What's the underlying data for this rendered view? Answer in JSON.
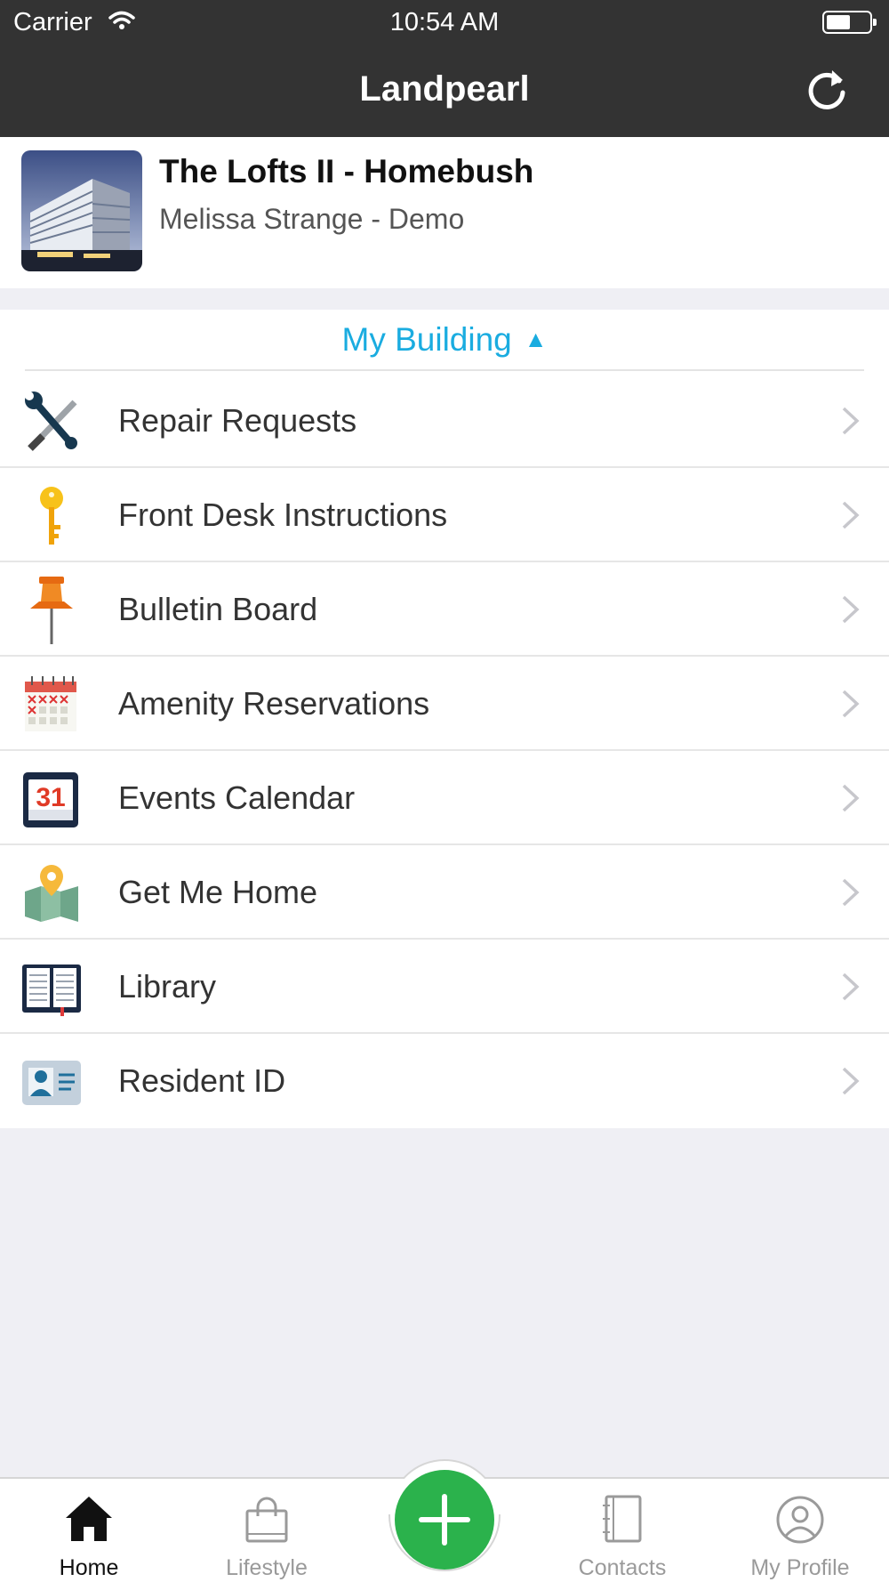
{
  "status_bar": {
    "carrier": "Carrier",
    "time": "10:54 AM"
  },
  "nav": {
    "title": "Landpearl"
  },
  "property": {
    "name": "The Lofts II - Homebush",
    "subtitle": "Melissa Strange - Demo"
  },
  "section": {
    "title": "My Building",
    "caret": "▲"
  },
  "menu": [
    {
      "label": "Repair Requests",
      "icon": "tools-icon"
    },
    {
      "label": "Front Desk Instructions",
      "icon": "key-icon"
    },
    {
      "label": "Bulletin Board",
      "icon": "pushpin-icon"
    },
    {
      "label": "Amenity Reservations",
      "icon": "reservation-calendar-icon"
    },
    {
      "label": "Events Calendar",
      "icon": "calendar-31-icon",
      "icon_text": "31"
    },
    {
      "label": "Get Me Home",
      "icon": "map-pin-icon"
    },
    {
      "label": "Library",
      "icon": "open-book-icon"
    },
    {
      "label": "Resident ID",
      "icon": "id-card-icon"
    }
  ],
  "tabs": [
    {
      "label": "Home",
      "icon": "home-icon",
      "active": true
    },
    {
      "label": "Lifestyle",
      "icon": "shopping-bag-icon",
      "active": false
    },
    {
      "label": "",
      "icon": "plus-icon",
      "active": false
    },
    {
      "label": "Contacts",
      "icon": "contacts-book-icon",
      "active": false
    },
    {
      "label": "My Profile",
      "icon": "profile-icon",
      "active": false
    }
  ],
  "colors": {
    "bar": "#333333",
    "accent": "#1aace0",
    "fab": "#2bb24c",
    "background": "#efeff4"
  }
}
